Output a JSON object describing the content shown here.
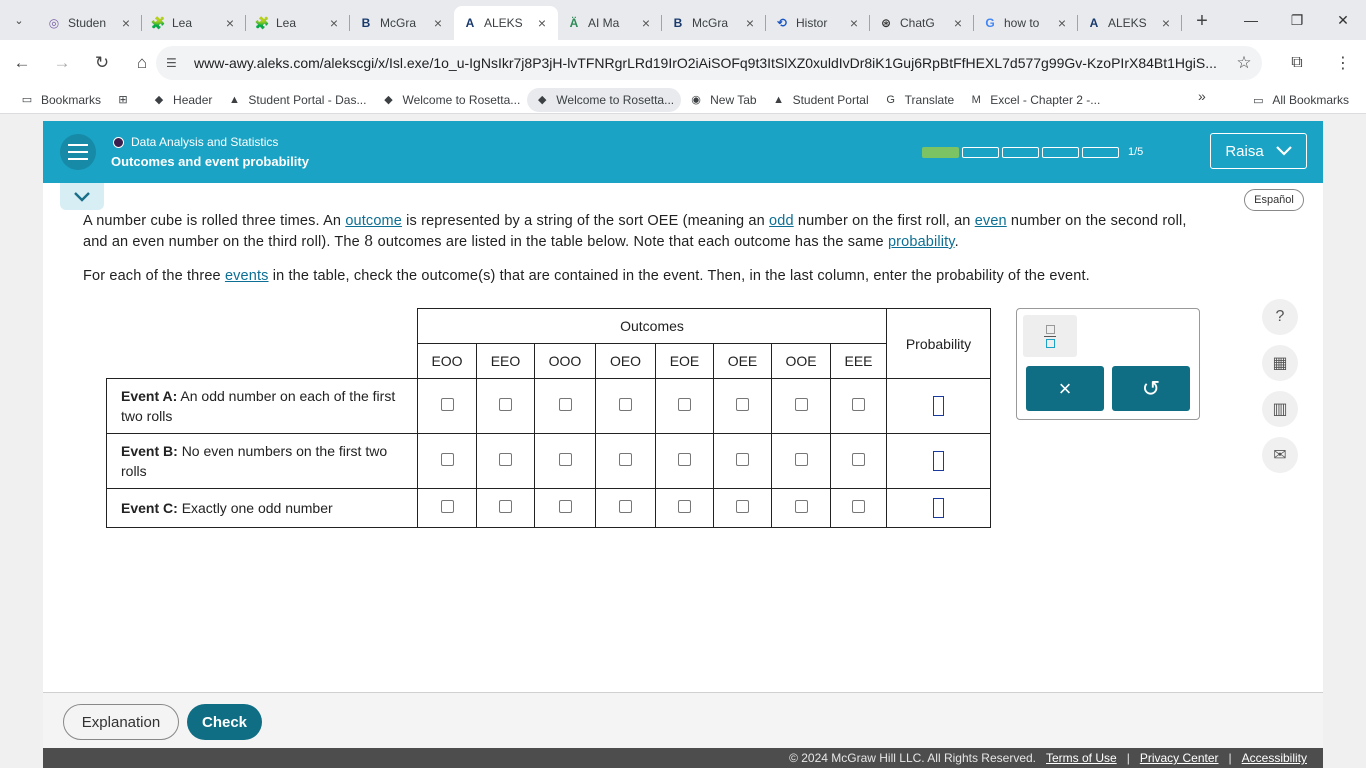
{
  "browser": {
    "tabs": [
      {
        "icon": "student-portal-icon",
        "glyph": "◎",
        "color": "#7b61a8",
        "title": "Studen"
      },
      {
        "icon": "mcgraw-puzzle-icon",
        "glyph": "🧩",
        "color": "#1a3a6e",
        "title": "Lea"
      },
      {
        "icon": "mcgraw-puzzle-icon",
        "glyph": "🧩",
        "color": "#1a3a6e",
        "title": "Lea"
      },
      {
        "icon": "mcgraw-icon",
        "glyph": "B",
        "color": "#1a3a6e",
        "title": "McGra"
      },
      {
        "icon": "aleks-icon",
        "glyph": "A",
        "color": "#1a3a6e",
        "title": "ALEKS"
      },
      {
        "icon": "ai-math-icon",
        "glyph": "Ä",
        "color": "#2e8b57",
        "title": "AI Ma"
      },
      {
        "icon": "mcgraw-icon",
        "glyph": "B",
        "color": "#1a3a6e",
        "title": "McGra"
      },
      {
        "icon": "history-icon",
        "glyph": "⟲",
        "color": "#1a56c4",
        "title": "Histor"
      },
      {
        "icon": "chatgpt-icon",
        "glyph": "⊛",
        "color": "#333333",
        "title": "ChatG"
      },
      {
        "icon": "google-icon",
        "glyph": "G",
        "color": "#4285f4",
        "title": "how to"
      },
      {
        "icon": "aleks-icon",
        "glyph": "A",
        "color": "#1a3a6e",
        "title": "ALEKS"
      }
    ],
    "active_tab": 4,
    "url": "www-awy.aleks.com/alekscgi/x/Isl.exe/1o_u-IgNsIkr7j8P3jH-lvTFNRgrLRd19IrO2iAiSOFq9t3ItSlXZ0xuldIvDr8iK1Guj6RpBtFfHEXL7d577g99Gv-KzoPIrX84Bt1HgiS...",
    "bookmarks": [
      {
        "icon": "folder-icon",
        "glyph": "▭",
        "label": "Bookmarks"
      },
      {
        "icon": "apps-grid-icon",
        "glyph": "⊞",
        "label": ""
      },
      {
        "icon": "rosetta-icon",
        "glyph": "◆",
        "label": "Header"
      },
      {
        "icon": "student-portal-icon",
        "glyph": "▲",
        "label": "Student Portal - Das..."
      },
      {
        "icon": "rosetta-icon",
        "glyph": "◆",
        "label": "Welcome to Rosetta..."
      },
      {
        "icon": "rosetta-icon",
        "glyph": "◆",
        "label": "Welcome to Rosetta..."
      },
      {
        "icon": "globe-icon",
        "glyph": "◉",
        "label": "New Tab"
      },
      {
        "icon": "student-portal-icon",
        "glyph": "▲",
        "label": "Student Portal"
      },
      {
        "icon": "translate-icon",
        "glyph": "G",
        "label": "Translate"
      },
      {
        "icon": "excel-icon",
        "glyph": "M",
        "label": "Excel - Chapter 2 -..."
      }
    ],
    "all_bookmarks": "All Bookmarks"
  },
  "header": {
    "course": "Data Analysis and Statistics",
    "topic": "Outcomes and event probability",
    "progress": {
      "completed": 1,
      "total": 5,
      "label": "1/5"
    },
    "user": "Raisa"
  },
  "espanol": "Español",
  "problem": {
    "p1a": "A number cube is rolled three times. An ",
    "l_outcome": "outcome",
    "p1b": " is represented by a string of the sort OEE (meaning an ",
    "l_odd": "odd",
    "p1c": " number on the first roll, an ",
    "l_even": "even",
    "p1d": " number on the second roll, and an even number on the third roll). The ",
    "n8": "8",
    "p1e": " outcomes are listed in the table below. Note that each outcome has the same ",
    "l_probability": "probability",
    "p1f": ".",
    "p2a": "For each of the three ",
    "l_events": "events",
    "p2b": " in the table, check the outcome(s) that are contained in the event. Then, in the last column, enter the probability of the event."
  },
  "table": {
    "outcomes_header": "Outcomes",
    "probability_header": "Probability",
    "outcomes": [
      "EOO",
      "EEO",
      "OOO",
      "OEO",
      "EOE",
      "OEE",
      "OOE",
      "EEE"
    ],
    "events": [
      {
        "name": "Event A:",
        "desc": "An odd number on each of the first two rolls"
      },
      {
        "name": "Event B:",
        "desc": "No even numbers on the first two rolls"
      },
      {
        "name": "Event C:",
        "desc": "Exactly one odd number"
      }
    ]
  },
  "keypad": {
    "clear": "×",
    "undo": "↺"
  },
  "footer": {
    "explanation": "Explanation",
    "check": "Check",
    "copyright": "© 2024 McGraw Hill LLC. All Rights Reserved.",
    "terms": "Terms of Use",
    "privacy": "Privacy Center",
    "accessibility": "Accessibility"
  }
}
